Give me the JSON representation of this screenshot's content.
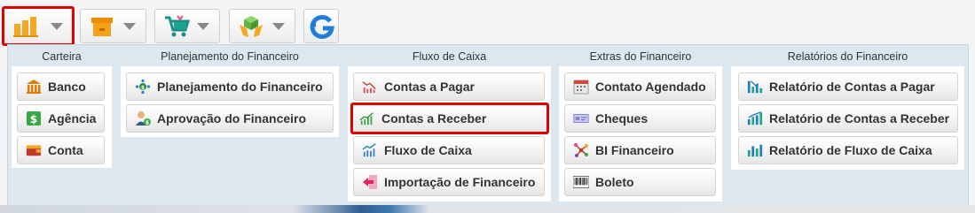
{
  "toolbar": {
    "buttons": [
      {
        "icon": "finance-bar-chart-icon",
        "active": true
      },
      {
        "icon": "box-icon",
        "active": false
      },
      {
        "icon": "shopping-cart-icon",
        "active": false
      },
      {
        "icon": "hands-cube-icon",
        "active": false
      },
      {
        "icon": "refresh-g-icon",
        "active": false
      }
    ]
  },
  "menu": {
    "columns": [
      {
        "title": "Carteira",
        "items": [
          {
            "label": "Banco",
            "icon": "bank-icon"
          },
          {
            "label": "Agência",
            "icon": "dollar-icon"
          },
          {
            "label": "Conta",
            "icon": "wallet-icon"
          }
        ]
      },
      {
        "title": "Planejamento do Financeiro",
        "items": [
          {
            "label": "Planejamento do Financeiro",
            "icon": "planning-icon"
          },
          {
            "label": "Aprovação do Financeiro",
            "icon": "approval-user-icon"
          }
        ]
      },
      {
        "title": "Fluxo de Caixa",
        "items": [
          {
            "label": "Contas a Pagar",
            "icon": "chart-down-icon"
          },
          {
            "label": "Contas a Receber",
            "icon": "chart-up-icon",
            "selected": true
          },
          {
            "label": "Fluxo de Caixa",
            "icon": "chart-line-icon"
          },
          {
            "label": "Importação de Financeiro",
            "icon": "import-arrow-icon"
          }
        ]
      },
      {
        "title": "Extras do Financeiro",
        "items": [
          {
            "label": "Contato Agendado",
            "icon": "calendar-icon"
          },
          {
            "label": "Cheques",
            "icon": "cheque-icon"
          },
          {
            "label": "BI Financeiro",
            "icon": "bi-network-icon"
          },
          {
            "label": "Boleto",
            "icon": "barcode-icon"
          }
        ]
      },
      {
        "title": "Relatórios do Financeiro",
        "items": [
          {
            "label": "Relatório de Contas a Pagar",
            "icon": "report-chart-icon"
          },
          {
            "label": "Relatório de Contas a Receber",
            "icon": "report-chart-icon"
          },
          {
            "label": "Relatório de Fluxo de Caixa",
            "icon": "report-bars-icon"
          }
        ]
      }
    ]
  },
  "colors": {
    "highlight": "#e00000",
    "panel_bg": "#dde7ef",
    "accent_blue": "#1f7fbf"
  }
}
